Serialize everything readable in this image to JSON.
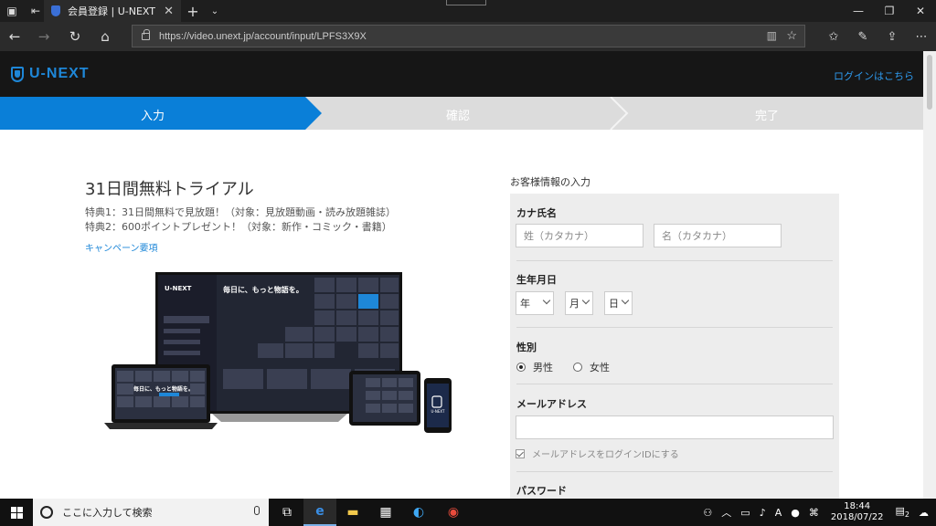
{
  "browser": {
    "tab_title": "会員登録 | U-NEXT",
    "url": "https://video.unext.jp/account/input/LPFS3X9X"
  },
  "site": {
    "logo_text": "U-NEXT",
    "login_link": "ログインはこちら"
  },
  "steps": [
    {
      "label": "入力",
      "active": true
    },
    {
      "label": "確認",
      "active": false
    },
    {
      "label": "完了",
      "active": false
    }
  ],
  "promo": {
    "title": "31日間無料トライアル",
    "perk1": "特典1：31日間無料で見放題！（対象：見放題動画・読み放題雑誌）",
    "perk2": "特典2：600ポイントプレゼント！（対象：新作・コミック・書籍）",
    "campaign_link": "キャンペーン要項",
    "tv_logo": "U-NEXT",
    "tv_headline": "毎日に、もっと物語を。",
    "laptop_headline": "毎日に、もっと物語を。",
    "phone_logo": "U-NEXT"
  },
  "form": {
    "title": "お客様情報の入力",
    "kana_label": "カナ氏名",
    "last_name_placeholder": "姓（カタカナ）",
    "first_name_placeholder": "名（カタカナ）",
    "birth_label": "生年月日",
    "year_label": "年",
    "month_label": "月",
    "day_label": "日",
    "gender_label": "性別",
    "gender_male": "男性",
    "gender_female": "女性",
    "email_label": "メールアドレス",
    "email_as_login": "メールアドレスをログインIDにする",
    "password_label": "パスワード"
  },
  "taskbar": {
    "search_placeholder": "ここに入力して検索",
    "time": "18:44",
    "date": "2018/07/22",
    "notification_count": "2",
    "ime": "A"
  },
  "colors": {
    "accent": "#0a7fd8",
    "step_inactive": "#dcdcdc",
    "header_bg": "#161616"
  }
}
